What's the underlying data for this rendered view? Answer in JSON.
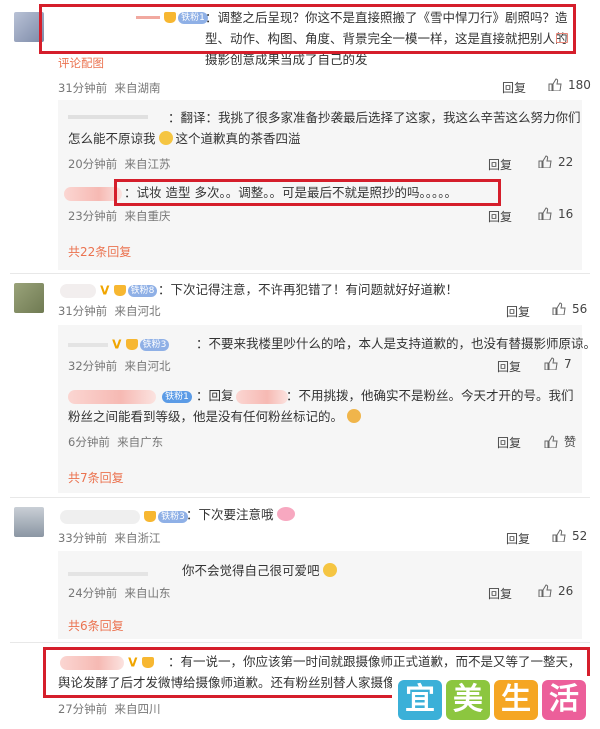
{
  "comments": [
    {
      "text": "：调整之后呈现？你这不是直接照搬了《雪中悍刀行》剧照吗？造型、动作、构图、角度、背景完全一模一样，这是直接就把别人的摄影创意成果当成了自己的发",
      "badge": "铁粉1",
      "extra": "评论配图",
      "time": "31分钟前",
      "source": "来自湖南",
      "reply_label": "回复",
      "likes": "180",
      "replies": [
        {
          "text": "：翻译：我挑了很多家准备抄袭最后选择了这家，我这么辛苦这么努力你们怎么能不原谅我",
          "text2": "这个道歉真的茶香四溢",
          "time": "20分钟前",
          "source": "来自江苏",
          "reply_label": "回复",
          "likes": "22"
        },
        {
          "text": "：试妆 造型 多次。。调整。。可是最后不就是照抄的吗。。。。。",
          "time": "23分钟前",
          "source": "来自重庆",
          "reply_label": "回复",
          "likes": "16"
        }
      ],
      "more": "共22条回复"
    },
    {
      "text": "：下次记得注意，不许再犯错了！有问题就好好道歉！",
      "badge": "铁粉8",
      "time": "31分钟前",
      "source": "来自河北",
      "reply_label": "回复",
      "likes": "56",
      "replies": [
        {
          "text": "：不要来我楼里吵什么的哈，本人是支持道歉的，也没有替摄影师原谅。",
          "badge": "铁粉3",
          "time": "32分钟前",
          "source": "来自河北",
          "reply_label": "回复",
          "likes": "7"
        },
        {
          "badge": "铁粉1",
          "mid": "：回复",
          "text": "：不用挑拨，他确实不是粉丝。今天才开的号。我们粉丝之间能看到等级，他是没有任何粉丝标记的。",
          "time": "6分钟前",
          "source": "来自广东",
          "reply_label": "回复",
          "likes": "赞"
        }
      ],
      "more": "共7条回复"
    },
    {
      "text": "：下次要注意哦",
      "badge": "铁粉3",
      "time": "33分钟前",
      "source": "来自浙江",
      "reply_label": "回复",
      "likes": "52",
      "replies": [
        {
          "text": "你不会觉得自己很可爱吧",
          "time": "24分钟前",
          "source": "来自山东",
          "reply_label": "回复",
          "likes": "26"
        }
      ],
      "more": "共6条回复"
    },
    {
      "text": "：有一说一，你应该第一时间就跟摄像师正式道歉，而不是又等了一整天，舆论发酵了后才发微博给摄像师道歉。还有粉丝别替人家摄像师",
      "time": "27分钟前",
      "source": "来自四川"
    }
  ],
  "watermark": [
    "宜",
    "美",
    "生",
    "活"
  ],
  "colors": {
    "highlight_box": "#d51e2b",
    "link_orange": "#eb7350",
    "reply_bg": "#f6f6f6"
  }
}
